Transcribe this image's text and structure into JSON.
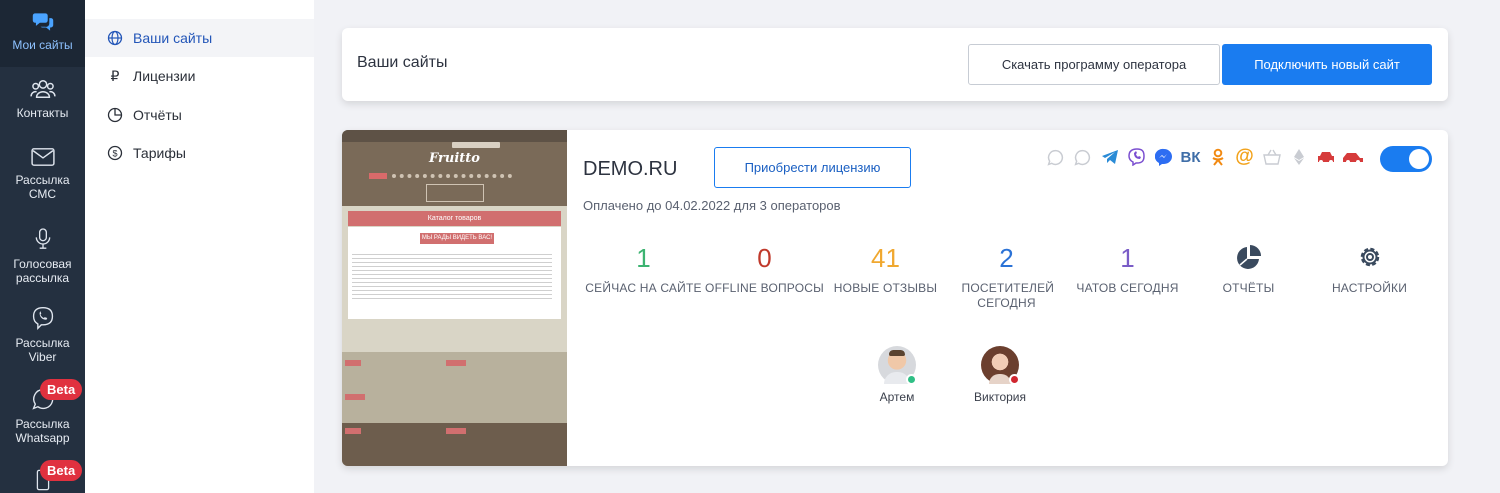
{
  "rail": {
    "items": [
      {
        "label": "Мои сайты",
        "icon": "chat-icon"
      },
      {
        "label": "Контакты",
        "icon": "contacts-icon"
      },
      {
        "label": "Рассылка СМС",
        "icon": "mail-icon"
      },
      {
        "label": "Голосовая рассылка",
        "icon": "microphone-icon"
      },
      {
        "label": "Рассылка Viber",
        "icon": "viber-icon"
      },
      {
        "label": "Рассылка Whatsapp",
        "icon": "whatsapp-icon",
        "badge": "Beta"
      },
      {
        "label": "",
        "icon": "phone-icon",
        "badge": "Beta"
      }
    ]
  },
  "subnav": {
    "items": [
      {
        "label": "Ваши сайты",
        "icon": "globe-icon"
      },
      {
        "label": "Лицензии",
        "icon": "ruble-icon"
      },
      {
        "label": "Отчёты",
        "icon": "pie-chart-icon"
      },
      {
        "label": "Тарифы",
        "icon": "dollar-icon"
      }
    ]
  },
  "header": {
    "title": "Ваши сайты",
    "download_label": "Скачать программу оператора",
    "connect_label": "Подключить новый сайт"
  },
  "site": {
    "name": "DEMO.RU",
    "license_label": "Приобрести лицензию",
    "paid_text": "Оплачено до 04.02.2022 для 3 операторов",
    "enabled": true,
    "channels": [
      {
        "icon": "whatsapp-icon",
        "color": "#c9ccd2"
      },
      {
        "icon": "whatsapp-icon",
        "color": "#c9ccd2"
      },
      {
        "icon": "telegram-icon",
        "color": "#2a8bd6"
      },
      {
        "icon": "viber-icon",
        "color": "#7b4fd0"
      },
      {
        "icon": "messenger-icon",
        "color": "#2d6df2"
      },
      {
        "icon": "vk-icon",
        "color": "#3f6ea8"
      },
      {
        "icon": "odnoklassniki-icon",
        "color": "#f28a12"
      },
      {
        "icon": "email-icon",
        "color": "#f2a21a"
      },
      {
        "icon": "basket-icon",
        "color": "#c9ccd2"
      },
      {
        "icon": "ethereum-icon",
        "color": "#c9ccd2"
      },
      {
        "icon": "car-icon",
        "color": "#d63b3b"
      },
      {
        "icon": "car-side-icon",
        "color": "#d63b3b"
      }
    ],
    "stats": [
      {
        "value": "1",
        "label": "СЕЙЧАС НА САЙТЕ",
        "color": "#3cb371"
      },
      {
        "value": "0",
        "label": "OFFLINE ВОПРОСЫ",
        "color": "#c0392b"
      },
      {
        "value": "41",
        "label": "НОВЫЕ ОТЗЫВЫ",
        "color": "#f0a830"
      },
      {
        "value": "2",
        "label": "ПОСЕТИТЕЛЕЙ СЕГОДНЯ",
        "color": "#2b72d6"
      },
      {
        "value": "1",
        "label": "ЧАТОВ СЕГОДНЯ",
        "color": "#7a5cc7"
      },
      {
        "value": "",
        "label": "ОТЧЁТЫ",
        "icon": "pie-chart-icon"
      },
      {
        "value": "",
        "label": "НАСТРОЙКИ",
        "icon": "gear-icon"
      }
    ],
    "operators": [
      {
        "name": "Артем",
        "status_color": "#2fbf85"
      },
      {
        "name": "Виктория",
        "status_color": "#d0262f"
      }
    ],
    "thumbnail": {
      "logo": "Fruitto",
      "catalog": "Каталог товаров",
      "banner": "МЫ РАДЫ ВИДЕТЬ ВАС!"
    }
  }
}
